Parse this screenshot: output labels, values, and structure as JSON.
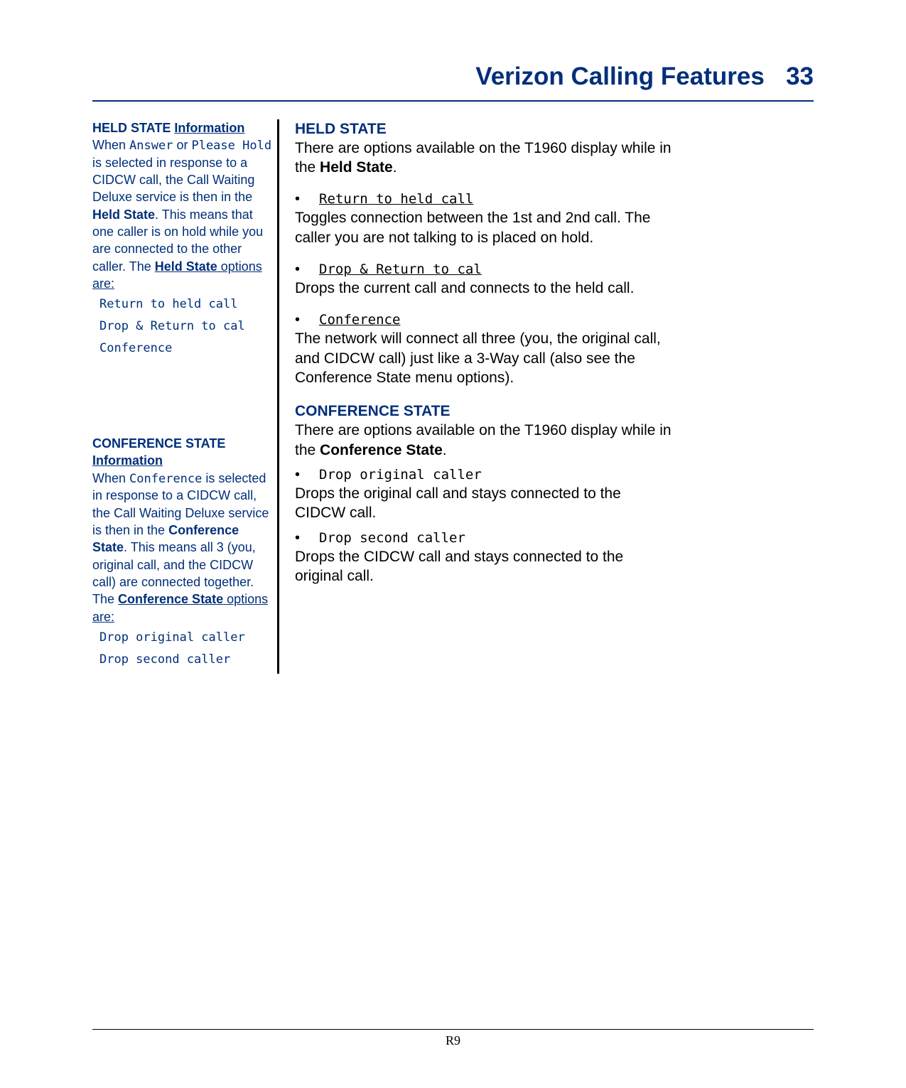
{
  "header": {
    "title": "Verizon Calling Features",
    "page_number": "33"
  },
  "sidebar": {
    "held": {
      "title": "HELD STATE Information",
      "text_before": "When ",
      "mono1": "Answer",
      "text_mid1": " or ",
      "mono2": "Please Hold",
      "text_mid2": " is selected in response to a CIDCW call, the Call Waiting Deluxe service is then in the ",
      "bold1": "Held State",
      "text_mid3": ".  This means that one caller is on hold while you are connected to the other caller.  The ",
      "bold2": "Held State",
      "text_after": " options are:",
      "options": [
        "Return to held call",
        "Drop & Return to cal",
        "Conference"
      ]
    },
    "conf": {
      "title": "CONFERENCE STATE Information",
      "text_before": "When ",
      "mono1": "Conference",
      "text_mid1": " is selected in response to a CIDCW call, the Call Waiting Deluxe service is then in the ",
      "bold1": "Conference State",
      "text_mid2": ".  This means all 3 (you, original call, and the CIDCW call) are connected together.  The ",
      "bold2": "Conference State",
      "text_after": " options are:",
      "options": [
        "Drop original caller",
        "Drop second caller"
      ]
    }
  },
  "main": {
    "held": {
      "heading": "HELD STATE",
      "intro_pre": "There are options available on the T1960 display while in the ",
      "intro_bold": "Held State",
      "intro_post": ".",
      "items": [
        {
          "label": "Return to held call",
          "desc": "Toggles connection between the 1st and 2nd call.  The caller you are not talking to is placed on hold."
        },
        {
          "label": "Drop & Return to cal",
          "desc": "Drops the current call and connects to the held call."
        },
        {
          "label": "Conference",
          "desc": "The network will connect all three (you, the original call, and CIDCW call) just like a 3-Way call (also see the Conference State menu options)."
        }
      ]
    },
    "conf": {
      "heading": "CONFERENCE STATE",
      "intro_pre": "There are options available on the T1960 display while in the ",
      "intro_bold": "Conference State",
      "intro_post": ".",
      "items": [
        {
          "label": "Drop original caller",
          "desc": "Drops the original call and stays connected to the CIDCW call."
        },
        {
          "label": "Drop second caller",
          "desc": "Drops the CIDCW call and stays connected to the original call."
        }
      ]
    }
  },
  "footer": "R9"
}
